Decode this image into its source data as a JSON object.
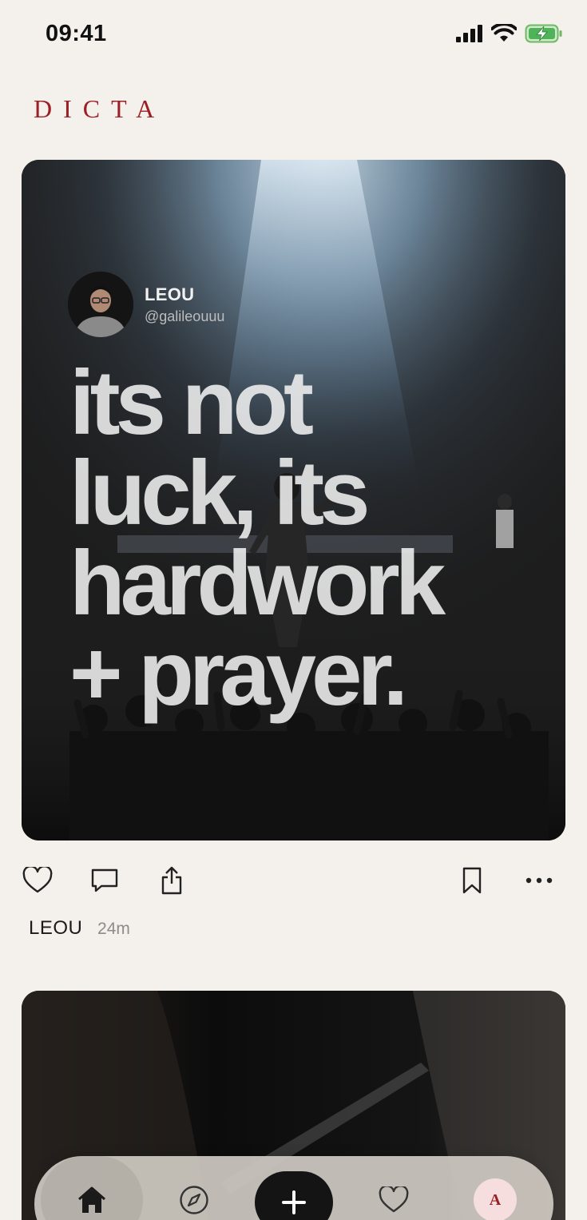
{
  "status_bar": {
    "time": "09:41",
    "icons": [
      "cellular-signal-icon",
      "wifi-icon",
      "battery-charging-icon"
    ]
  },
  "app": {
    "logo": "DICTA",
    "brand_color": "#9c1f26",
    "background_color": "#f4f1ec"
  },
  "feed": {
    "posts": [
      {
        "author_name": "LEOU",
        "author_handle": "@galileouuu",
        "quote_lines": [
          "its not",
          "luck, its",
          "hardwork",
          "+ prayer."
        ],
        "timestamp": "24m",
        "actions": [
          "heart-icon",
          "comment-icon",
          "share-icon",
          "bookmark-icon",
          "more-icon"
        ]
      }
    ]
  },
  "tab_bar": {
    "items": [
      "home-icon",
      "compass-icon",
      "plus-icon",
      "heart-icon",
      "profile-avatar"
    ],
    "active": "home",
    "profile_initial": "A"
  }
}
